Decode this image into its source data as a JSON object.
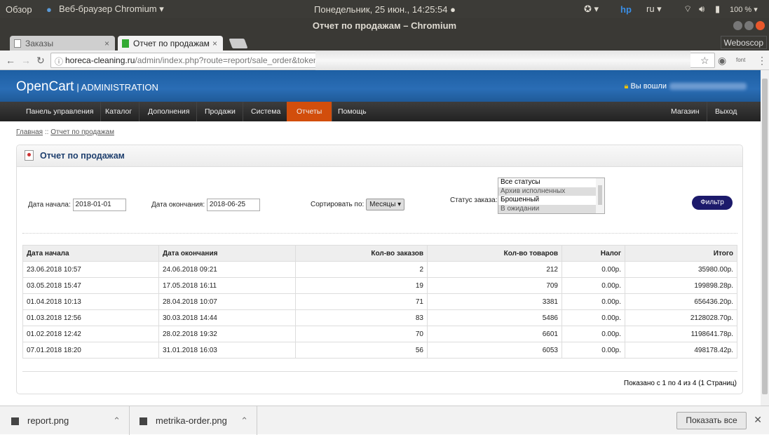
{
  "os": {
    "overview": "Обзор",
    "app": "Веб-браузер Chromium ▾",
    "clock": "Понедельник, 25 июн., 14:25:54 ●",
    "lang": "ru ▾",
    "battery": "100 % ▾"
  },
  "window": {
    "title": "Отчет по продажам – Chromium"
  },
  "tabs": [
    {
      "label": "Заказы"
    },
    {
      "label": "Отчет по продажам"
    }
  ],
  "weboscop": "Weboscop",
  "address": {
    "host": "horeca-cleaning.ru",
    "path": "/admin/index.php?route=report/sale_order&token="
  },
  "header": {
    "logo": "OpenCart",
    "subtitle": "| ADMINISTRATION",
    "login": "Вы вошли"
  },
  "menu": [
    "Панель управления",
    "Каталог",
    "Дополнения",
    "Продажи",
    "Система",
    "Отчеты",
    "Помощь"
  ],
  "menu_right": [
    "Магазин",
    "Выход"
  ],
  "breadcrumb": [
    "Главная",
    "Отчет по продажам"
  ],
  "box_title": "Отчет по продажам",
  "filter": {
    "start_label": "Дата начала:",
    "start": "2018-01-01",
    "end_label": "Дата окончания:",
    "end": "2018-06-25",
    "group_label": "Сортировать по:",
    "group": "Месяцы",
    "status_label": "Статус заказа:",
    "statuses": [
      "Все статусы",
      "Архив исполненных",
      "Брошенный",
      "В ожидании"
    ],
    "button": "Фильтр"
  },
  "table": {
    "headers": [
      "Дата начала",
      "Дата окончания",
      "Кол-во заказов",
      "Кол-во товаров",
      "Налог",
      "Итого"
    ],
    "rows": [
      [
        "23.06.2018 10:57",
        "24.06.2018 09:21",
        "2",
        "212",
        "0.00р.",
        "35980.00р."
      ],
      [
        "03.05.2018 15:47",
        "17.05.2018 16:11",
        "19",
        "709",
        "0.00р.",
        "199898.28р."
      ],
      [
        "01.04.2018 10:13",
        "28.04.2018 10:07",
        "71",
        "3381",
        "0.00р.",
        "656436.20р."
      ],
      [
        "01.03.2018 12:56",
        "30.03.2018 14:44",
        "83",
        "5486",
        "0.00р.",
        "2128028.70р."
      ],
      [
        "01.02.2018 12:42",
        "28.02.2018 19:32",
        "70",
        "6601",
        "0.00р.",
        "1198641.78р."
      ],
      [
        "07.01.2018 18:20",
        "31.01.2018 16:03",
        "56",
        "6053",
        "0.00р.",
        "498178.42р."
      ]
    ]
  },
  "pagination": "Показано с 1 по 4 из 4 (1 Страниц)",
  "downloads": {
    "items": [
      "report.png",
      "metrika-order.png"
    ],
    "show_all": "Показать все"
  }
}
